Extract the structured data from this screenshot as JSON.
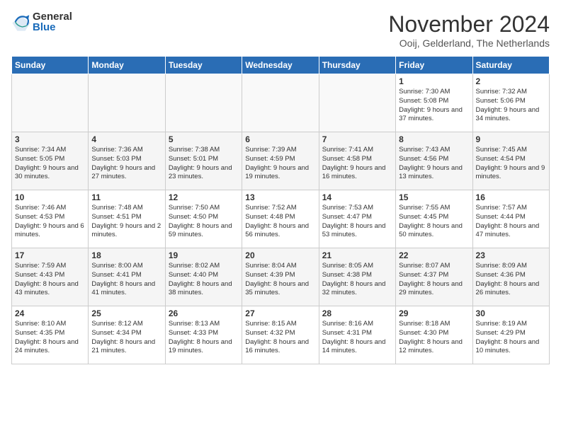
{
  "logo": {
    "general": "General",
    "blue": "Blue"
  },
  "header": {
    "title": "November 2024",
    "location": "Ooij, Gelderland, The Netherlands"
  },
  "days_of_week": [
    "Sunday",
    "Monday",
    "Tuesday",
    "Wednesday",
    "Thursday",
    "Friday",
    "Saturday"
  ],
  "weeks": [
    [
      {
        "day": "",
        "info": ""
      },
      {
        "day": "",
        "info": ""
      },
      {
        "day": "",
        "info": ""
      },
      {
        "day": "",
        "info": ""
      },
      {
        "day": "",
        "info": ""
      },
      {
        "day": "1",
        "info": "Sunrise: 7:30 AM\nSunset: 5:08 PM\nDaylight: 9 hours\nand 37 minutes."
      },
      {
        "day": "2",
        "info": "Sunrise: 7:32 AM\nSunset: 5:06 PM\nDaylight: 9 hours\nand 34 minutes."
      }
    ],
    [
      {
        "day": "3",
        "info": "Sunrise: 7:34 AM\nSunset: 5:05 PM\nDaylight: 9 hours\nand 30 minutes."
      },
      {
        "day": "4",
        "info": "Sunrise: 7:36 AM\nSunset: 5:03 PM\nDaylight: 9 hours\nand 27 minutes."
      },
      {
        "day": "5",
        "info": "Sunrise: 7:38 AM\nSunset: 5:01 PM\nDaylight: 9 hours\nand 23 minutes."
      },
      {
        "day": "6",
        "info": "Sunrise: 7:39 AM\nSunset: 4:59 PM\nDaylight: 9 hours\nand 19 minutes."
      },
      {
        "day": "7",
        "info": "Sunrise: 7:41 AM\nSunset: 4:58 PM\nDaylight: 9 hours\nand 16 minutes."
      },
      {
        "day": "8",
        "info": "Sunrise: 7:43 AM\nSunset: 4:56 PM\nDaylight: 9 hours\nand 13 minutes."
      },
      {
        "day": "9",
        "info": "Sunrise: 7:45 AM\nSunset: 4:54 PM\nDaylight: 9 hours\nand 9 minutes."
      }
    ],
    [
      {
        "day": "10",
        "info": "Sunrise: 7:46 AM\nSunset: 4:53 PM\nDaylight: 9 hours\nand 6 minutes."
      },
      {
        "day": "11",
        "info": "Sunrise: 7:48 AM\nSunset: 4:51 PM\nDaylight: 9 hours\nand 2 minutes."
      },
      {
        "day": "12",
        "info": "Sunrise: 7:50 AM\nSunset: 4:50 PM\nDaylight: 8 hours\nand 59 minutes."
      },
      {
        "day": "13",
        "info": "Sunrise: 7:52 AM\nSunset: 4:48 PM\nDaylight: 8 hours\nand 56 minutes."
      },
      {
        "day": "14",
        "info": "Sunrise: 7:53 AM\nSunset: 4:47 PM\nDaylight: 8 hours\nand 53 minutes."
      },
      {
        "day": "15",
        "info": "Sunrise: 7:55 AM\nSunset: 4:45 PM\nDaylight: 8 hours\nand 50 minutes."
      },
      {
        "day": "16",
        "info": "Sunrise: 7:57 AM\nSunset: 4:44 PM\nDaylight: 8 hours\nand 47 minutes."
      }
    ],
    [
      {
        "day": "17",
        "info": "Sunrise: 7:59 AM\nSunset: 4:43 PM\nDaylight: 8 hours\nand 43 minutes."
      },
      {
        "day": "18",
        "info": "Sunrise: 8:00 AM\nSunset: 4:41 PM\nDaylight: 8 hours\nand 41 minutes."
      },
      {
        "day": "19",
        "info": "Sunrise: 8:02 AM\nSunset: 4:40 PM\nDaylight: 8 hours\nand 38 minutes."
      },
      {
        "day": "20",
        "info": "Sunrise: 8:04 AM\nSunset: 4:39 PM\nDaylight: 8 hours\nand 35 minutes."
      },
      {
        "day": "21",
        "info": "Sunrise: 8:05 AM\nSunset: 4:38 PM\nDaylight: 8 hours\nand 32 minutes."
      },
      {
        "day": "22",
        "info": "Sunrise: 8:07 AM\nSunset: 4:37 PM\nDaylight: 8 hours\nand 29 minutes."
      },
      {
        "day": "23",
        "info": "Sunrise: 8:09 AM\nSunset: 4:36 PM\nDaylight: 8 hours\nand 26 minutes."
      }
    ],
    [
      {
        "day": "24",
        "info": "Sunrise: 8:10 AM\nSunset: 4:35 PM\nDaylight: 8 hours\nand 24 minutes."
      },
      {
        "day": "25",
        "info": "Sunrise: 8:12 AM\nSunset: 4:34 PM\nDaylight: 8 hours\nand 21 minutes."
      },
      {
        "day": "26",
        "info": "Sunrise: 8:13 AM\nSunset: 4:33 PM\nDaylight: 8 hours\nand 19 minutes."
      },
      {
        "day": "27",
        "info": "Sunrise: 8:15 AM\nSunset: 4:32 PM\nDaylight: 8 hours\nand 16 minutes."
      },
      {
        "day": "28",
        "info": "Sunrise: 8:16 AM\nSunset: 4:31 PM\nDaylight: 8 hours\nand 14 minutes."
      },
      {
        "day": "29",
        "info": "Sunrise: 8:18 AM\nSunset: 4:30 PM\nDaylight: 8 hours\nand 12 minutes."
      },
      {
        "day": "30",
        "info": "Sunrise: 8:19 AM\nSunset: 4:29 PM\nDaylight: 8 hours\nand 10 minutes."
      }
    ]
  ]
}
